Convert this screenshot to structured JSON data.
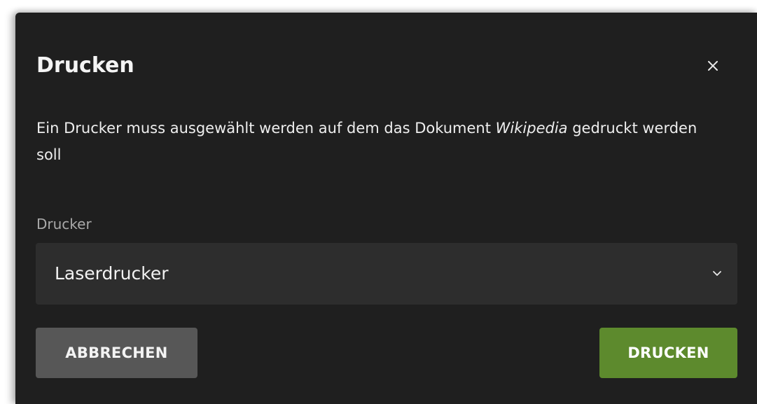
{
  "dialog": {
    "title": "Drucken",
    "close_icon": "close-icon",
    "message_before": "Ein Drucker muss ausgewählt werden auf dem das Dokument ",
    "message_document": "Wikipedia",
    "message_after": " gedruckt werden soll",
    "printer_label": "Drucker",
    "printer_selected": "Laserdrucker",
    "chevron_icon": "chevron-down-icon",
    "cancel_label": "ABBRECHEN",
    "print_label": "DRUCKEN"
  },
  "colors": {
    "dialog_background": "#1f1f1f",
    "select_background": "#2d2d2d",
    "cancel_button": "#575757",
    "print_button": "#5d8a2d"
  }
}
